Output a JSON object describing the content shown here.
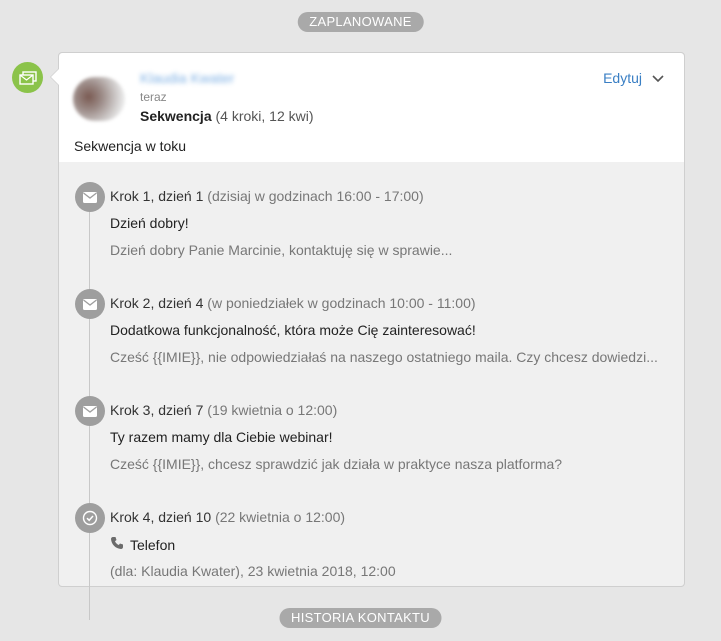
{
  "top_label": "ZAPLANOWANE",
  "bottom_label": "HISTORIA KONTAKTU",
  "card": {
    "author": "Klaudia Kwater",
    "time": "teraz",
    "sequence_name": "Sekwencja",
    "sequence_meta": "(4 kroki, 12 kwi)",
    "edit_label": "Edytuj",
    "status": "Sekwencja w toku"
  },
  "steps": [
    {
      "icon": "envelope-icon",
      "title": "Krok 1, dzień 1",
      "when": "(dzisiaj w godzinach 16:00 - 17:00)",
      "subject": "Dzień dobry!",
      "body": "Dzień dobry Panie Marcinie,  kontaktuję się w sprawie..."
    },
    {
      "icon": "envelope-icon",
      "title": "Krok 2, dzień 4",
      "when": "(w poniedziałek w godzinach 10:00 - 11:00)",
      "subject": "Dodatkowa funkcjonalność, która może Cię zainteresować!",
      "body": "Cześć {{IMIE}}, nie odpowiedziałaś na naszego ostatniego maila. Czy chcesz dowiedzi..."
    },
    {
      "icon": "envelope-icon",
      "title": "Krok 3, dzień 7",
      "when": "(19 kwietnia o 12:00)",
      "subject": "Ty razem mamy dla Ciebie webinar!",
      "body": "Cześć {{IMIE}}, chcesz sprawdzić jak działa w praktyce nasza platforma?"
    },
    {
      "icon": "check-circle-icon",
      "title": "Krok 4, dzień 10",
      "when": "(22 kwietnia o 12:00)",
      "subject": "Telefon",
      "body": "(dla: Klaudia Kwater), 23 kwietnia 2018, 12:00"
    }
  ],
  "colors": {
    "accent": "#3a7fc4",
    "badge": "#8bc34a",
    "step_icon": "#9e9e9e",
    "pill": "#a9a9a9"
  }
}
